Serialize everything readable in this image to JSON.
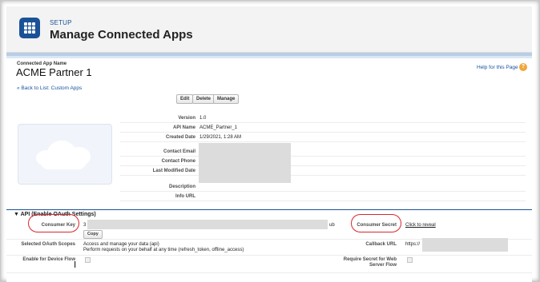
{
  "header": {
    "eyebrow": "SETUP",
    "title": "Manage Connected Apps",
    "brand_color": "#1b5297"
  },
  "app": {
    "eyebrow": "Connected App Name",
    "name": "ACME Partner 1",
    "help_link": "Help for this Page",
    "back_link": "« Back to List: Custom Apps"
  },
  "buttons": {
    "edit": "Edit",
    "delete": "Delete",
    "manage": "Manage",
    "copy": "Copy"
  },
  "details": [
    {
      "label": "Version",
      "value": "1.0"
    },
    {
      "label": "API Name",
      "value": "ACME_Partner_1"
    },
    {
      "label": "Created Date",
      "value": "1/29/2021, 1:28 AM"
    },
    {
      "label": "Contact Email",
      "value": ""
    },
    {
      "label": "Contact Phone",
      "value": ""
    },
    {
      "label": "Last Modified Date",
      "value": ""
    },
    {
      "label": "Description",
      "value": ""
    },
    {
      "label": "Info URL",
      "value": ""
    }
  ],
  "api_section": {
    "title": "▼ API (Enable OAuth Settings)",
    "consumer_key_label": "Consumer Key",
    "consumer_key_prefix": "3",
    "consumer_key_suffix": "ub",
    "consumer_secret_label": "Consumer Secret",
    "consumer_secret_link": "Click to reveal",
    "scopes_label": "Selected OAuth Scopes",
    "scopes_line1": "Access and manage your data (api)",
    "scopes_line2": "Perform requests on your behalf at any time (refresh_token, offline_access)",
    "callback_label": "Callback URL",
    "callback_value": "https://",
    "device_flow_label": "Enable for Device Flow",
    "require_secret_label_1": "Require Secret for Web",
    "require_secret_label_2": "Server Flow"
  },
  "colors": {
    "highlight": "#d9262c",
    "link": "#1a55a0"
  }
}
